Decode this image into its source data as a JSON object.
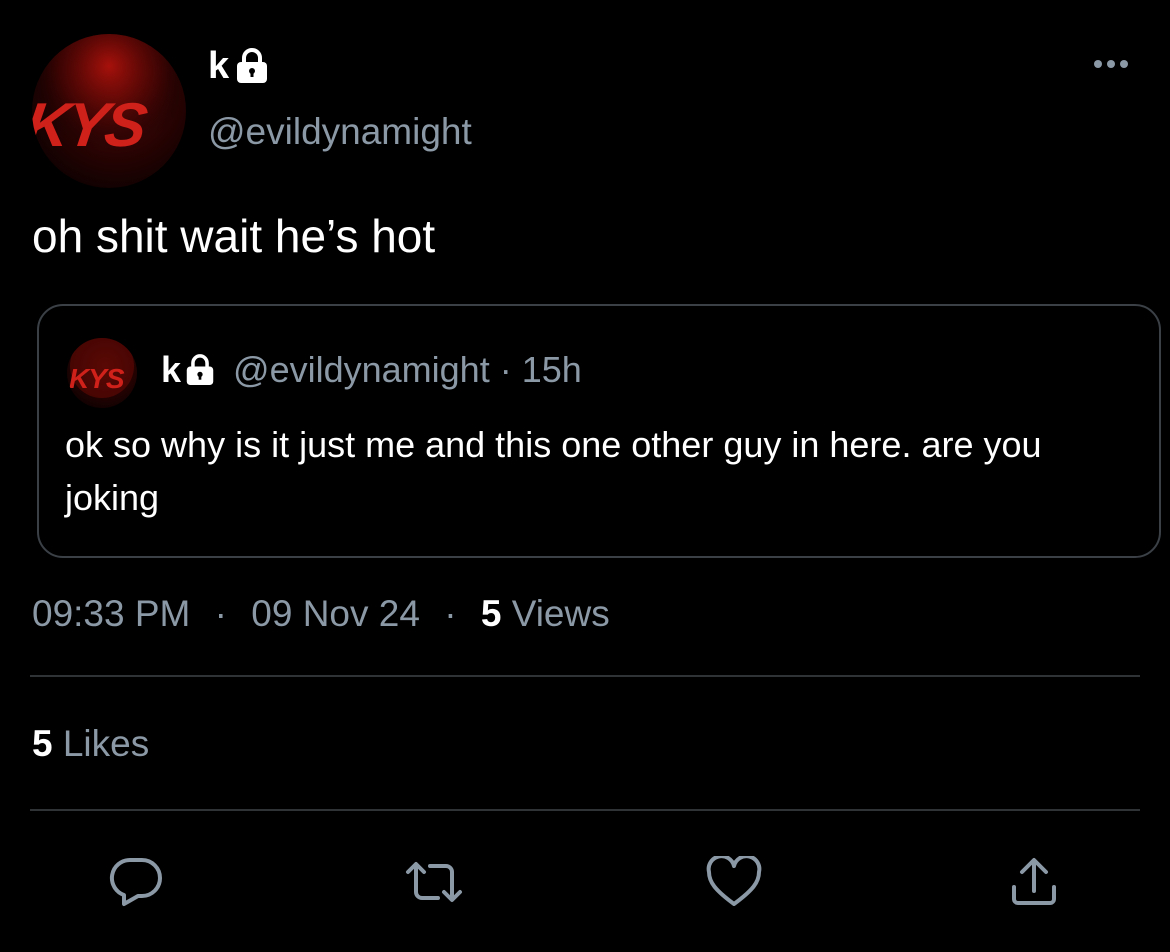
{
  "author": {
    "display_name": "k",
    "handle": "@evildynamight",
    "avatar_text": "KYS",
    "protected_icon": "lock-icon"
  },
  "tweet": {
    "text": "oh shit wait he’s hot",
    "time": "09:33 PM",
    "separator": "·",
    "date": "09 Nov 24",
    "views_count": "5",
    "views_label": "Views",
    "likes_count": "5",
    "likes_label": "Likes"
  },
  "quoted_tweet": {
    "display_name": "k",
    "handle": "@evildynamight",
    "separator": "·",
    "age": "15h",
    "text": "ok so why is it just me and this one other guy in here. are you joking",
    "avatar_text": "KYS"
  },
  "actions": {
    "reply_icon": "reply-icon",
    "retweet_icon": "retweet-icon",
    "like_icon": "heart-icon",
    "share_icon": "share-icon",
    "more_icon": "more-icon"
  },
  "colors": {
    "background": "#000000",
    "primary_text": "#ffffff",
    "secondary_text": "#8b98a5",
    "divider": "#2f3336",
    "avatar_red": "#d0201a"
  }
}
